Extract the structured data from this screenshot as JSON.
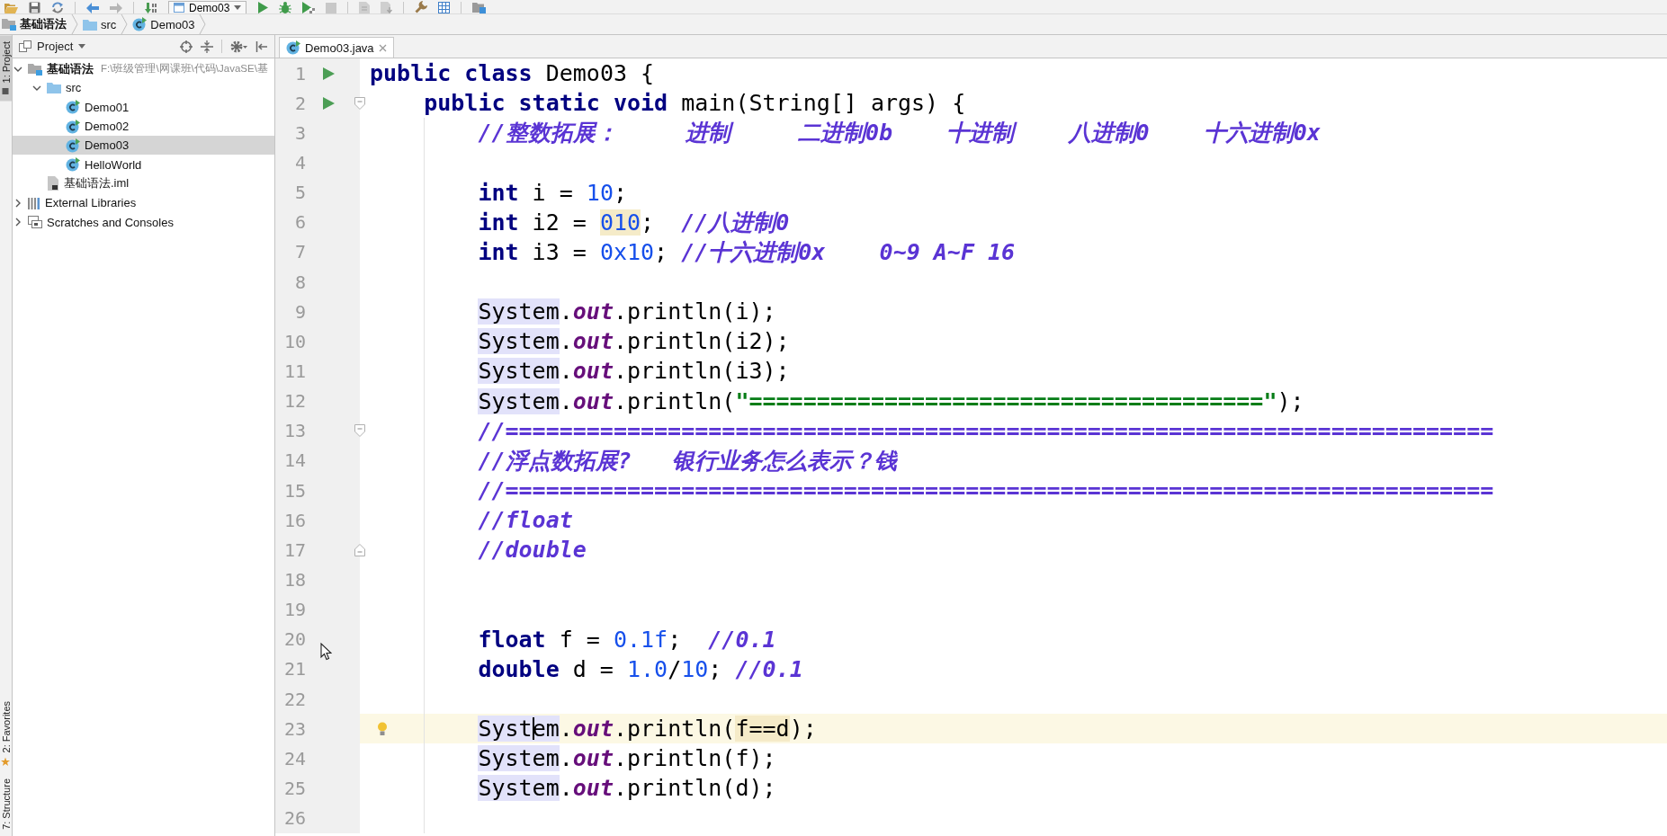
{
  "toolbar": {
    "run_configuration": "Demo03"
  },
  "breadcrumbs": [
    {
      "label": "基础语法",
      "kind": "module"
    },
    {
      "label": "src",
      "kind": "folder"
    },
    {
      "label": "Demo03",
      "kind": "class"
    }
  ],
  "side_strip": {
    "top_tabs": [
      {
        "label": "1: Project",
        "kind": "project",
        "selected": true
      }
    ],
    "bottom_tabs": [
      {
        "label": "2: Favorites",
        "kind": "favorites",
        "selected": false
      },
      {
        "label": "7: Structure",
        "selected": false
      }
    ]
  },
  "project_panel": {
    "title": "Project",
    "tree": [
      {
        "label": "基础语法",
        "kind": "module",
        "path": "F:\\班级管理\\网课班\\代码\\JavaSE\\基",
        "expanded": true,
        "selected": false,
        "children": [
          {
            "label": "src",
            "kind": "folder",
            "expanded": true,
            "selected": false,
            "children": [
              {
                "label": "Demo01",
                "kind": "class",
                "selected": false
              },
              {
                "label": "Demo02",
                "kind": "class",
                "selected": false
              },
              {
                "label": "Demo03",
                "kind": "class",
                "selected": true
              },
              {
                "label": "HelloWorld",
                "kind": "class",
                "selected": false
              }
            ]
          },
          {
            "label": "基础语法.iml",
            "kind": "iml",
            "selected": false
          }
        ]
      },
      {
        "label": "External Libraries",
        "kind": "library",
        "expanded": false,
        "selected": false
      },
      {
        "label": "Scratches and Consoles",
        "kind": "scratches",
        "expanded": false,
        "selected": false
      }
    ]
  },
  "editor": {
    "tabs": [
      {
        "label": "Demo03.java",
        "selected": true
      }
    ],
    "lines": [
      {
        "number": "1",
        "run": true,
        "current": false,
        "tokens": [
          {
            "text": "public class",
            "kind": "keyword"
          },
          {
            "text": " Demo03 {",
            "kind": "plain"
          }
        ],
        "children": [
          {
            "number": "2",
            "run": true,
            "fold_start": true,
            "current": false,
            "tokens": [
              {
                "text": "public static void",
                "kind": "keyword"
              },
              {
                "text": " main(String[] args) {",
                "kind": "plain"
              }
            ],
            "children": [
              {
                "number": "3",
                "current": false,
                "tokens": [
                  {
                    "text": "//整数拓展：     进制     二进制0b    十进制    八进制0    十六进制0x",
                    "kind": "comment"
                  }
                ]
              },
              {
                "number": "4",
                "current": false
              },
              {
                "number": "5",
                "current": false,
                "tokens": [
                  {
                    "text": "int",
                    "kind": "keyword"
                  },
                  {
                    "text": " i = ",
                    "kind": "plain"
                  },
                  {
                    "text": "10",
                    "kind": "number"
                  },
                  {
                    "text": ";",
                    "kind": "plain"
                  }
                ]
              },
              {
                "number": "6",
                "current": false,
                "tokens": [
                  {
                    "text": "int",
                    "kind": "keyword"
                  },
                  {
                    "text": " i2 = ",
                    "kind": "plain"
                  },
                  {
                    "text": "010",
                    "kind": "number",
                    "warning_highlight": true
                  },
                  {
                    "text": ";  ",
                    "kind": "plain"
                  },
                  {
                    "text": "//八进制0",
                    "kind": "comment"
                  }
                ]
              },
              {
                "number": "7",
                "current": false,
                "tokens": [
                  {
                    "text": "int",
                    "kind": "keyword"
                  },
                  {
                    "text": " i3 = ",
                    "kind": "plain"
                  },
                  {
                    "text": "0x10",
                    "kind": "number"
                  },
                  {
                    "text": "; ",
                    "kind": "plain"
                  },
                  {
                    "text": "//十六进制0x    0~9 A~F 16",
                    "kind": "comment"
                  }
                ]
              },
              {
                "number": "8",
                "current": false
              },
              {
                "number": "9",
                "current": false,
                "tokens": [
                  {
                    "text": "System",
                    "kind": "plain",
                    "usage_highlight": true
                  },
                  {
                    "text": ".",
                    "kind": "plain"
                  },
                  {
                    "text": "out",
                    "kind": "field"
                  },
                  {
                    "text": ".println(i);",
                    "kind": "plain"
                  }
                ]
              },
              {
                "number": "10",
                "current": false,
                "tokens": [
                  {
                    "text": "System",
                    "kind": "plain",
                    "usage_highlight": true
                  },
                  {
                    "text": ".",
                    "kind": "plain"
                  },
                  {
                    "text": "out",
                    "kind": "field"
                  },
                  {
                    "text": ".println(i2);",
                    "kind": "plain"
                  }
                ]
              },
              {
                "number": "11",
                "current": false,
                "tokens": [
                  {
                    "text": "System",
                    "kind": "plain",
                    "usage_highlight": true
                  },
                  {
                    "text": ".",
                    "kind": "plain"
                  },
                  {
                    "text": "out",
                    "kind": "field"
                  },
                  {
                    "text": ".println(i3);",
                    "kind": "plain"
                  }
                ]
              },
              {
                "number": "12",
                "current": false,
                "tokens": [
                  {
                    "text": "System",
                    "kind": "plain",
                    "usage_highlight": true
                  },
                  {
                    "text": ".",
                    "kind": "plain"
                  },
                  {
                    "text": "out",
                    "kind": "field"
                  },
                  {
                    "text": ".println(",
                    "kind": "plain"
                  },
                  {
                    "text": "\"======================================\"",
                    "kind": "string"
                  },
                  {
                    "text": ");",
                    "kind": "plain"
                  }
                ]
              },
              {
                "number": "13",
                "fold_start": true,
                "current": false,
                "tokens": [
                  {
                    "text": "//=========================================================================",
                    "kind": "comment"
                  }
                ]
              },
              {
                "number": "14",
                "current": false,
                "tokens": [
                  {
                    "text": "//浮点数拓展?   银行业务怎么表示？钱",
                    "kind": "comment"
                  }
                ]
              },
              {
                "number": "15",
                "current": false,
                "tokens": [
                  {
                    "text": "//=========================================================================",
                    "kind": "comment"
                  }
                ]
              },
              {
                "number": "16",
                "current": false,
                "tokens": [
                  {
                    "text": "//float",
                    "kind": "comment"
                  }
                ]
              },
              {
                "number": "17",
                "fold_end": true,
                "current": false,
                "tokens": [
                  {
                    "text": "//double",
                    "kind": "comment"
                  }
                ]
              },
              {
                "number": "18",
                "current": false
              },
              {
                "number": "19",
                "current": false
              },
              {
                "number": "20",
                "current": false,
                "tokens": [
                  {
                    "text": "float",
                    "kind": "keyword"
                  },
                  {
                    "text": " f = ",
                    "kind": "plain"
                  },
                  {
                    "text": "0.1f",
                    "kind": "number"
                  },
                  {
                    "text": ";  ",
                    "kind": "plain"
                  },
                  {
                    "text": "//0.1",
                    "kind": "comment"
                  }
                ]
              },
              {
                "number": "21",
                "current": false,
                "tokens": [
                  {
                    "text": "double",
                    "kind": "keyword"
                  },
                  {
                    "text": " d = ",
                    "kind": "plain"
                  },
                  {
                    "text": "1.0",
                    "kind": "number"
                  },
                  {
                    "text": "/",
                    "kind": "plain"
                  },
                  {
                    "text": "10",
                    "kind": "number"
                  },
                  {
                    "text": "; ",
                    "kind": "plain"
                  },
                  {
                    "text": "//0.1",
                    "kind": "comment"
                  }
                ]
              },
              {
                "number": "22",
                "current": false
              },
              {
                "number": "23",
                "bulb": true,
                "current": true,
                "tokens": [
                  {
                    "text": "Syst",
                    "kind": "plain",
                    "usage_highlight": true,
                    "caret_after": true
                  },
                  {
                    "text": "em",
                    "kind": "plain",
                    "usage_highlight": true
                  },
                  {
                    "text": ".",
                    "kind": "plain"
                  },
                  {
                    "text": "out",
                    "kind": "field"
                  },
                  {
                    "text": ".println(",
                    "kind": "plain"
                  },
                  {
                    "text": "f==d",
                    "kind": "plain",
                    "warning_highlight": true
                  },
                  {
                    "text": ");",
                    "kind": "plain"
                  }
                ]
              },
              {
                "number": "24",
                "current": false,
                "tokens": [
                  {
                    "text": "System",
                    "kind": "plain",
                    "usage_highlight": true
                  },
                  {
                    "text": ".",
                    "kind": "plain"
                  },
                  {
                    "text": "out",
                    "kind": "field"
                  },
                  {
                    "text": ".println(f);",
                    "kind": "plain"
                  }
                ]
              },
              {
                "number": "25",
                "current": false,
                "tokens": [
                  {
                    "text": "System",
                    "kind": "plain",
                    "usage_highlight": true
                  },
                  {
                    "text": ".",
                    "kind": "plain"
                  },
                  {
                    "text": "out",
                    "kind": "field"
                  },
                  {
                    "text": ".println(d);",
                    "kind": "plain"
                  }
                ]
              },
              {
                "number": "26",
                "current": false
              }
            ]
          }
        ]
      }
    ]
  }
}
